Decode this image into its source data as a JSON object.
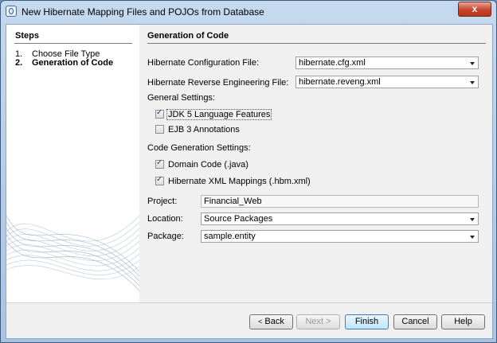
{
  "window": {
    "title": "New Hibernate Mapping Files and POJOs from Database",
    "close_glyph": "x"
  },
  "steps": {
    "heading": "Steps",
    "items": [
      {
        "num": "1.",
        "label": "Choose File Type"
      },
      {
        "num": "2.",
        "label": "Generation of Code",
        "active": true
      }
    ]
  },
  "main": {
    "heading": "Generation of Code",
    "config_file": {
      "label": "Hibernate Configuration File:",
      "value": "hibernate.cfg.xml"
    },
    "reveng_file": {
      "label": "Hibernate Reverse Engineering File:",
      "value": "hibernate.reveng.xml"
    },
    "general": {
      "label": "General Settings:",
      "jdk5": {
        "label": "JDK 5 Language Features",
        "checked": true
      },
      "ejb3": {
        "label": "EJB 3 Annotations",
        "checked": false
      }
    },
    "codegen": {
      "label": "Code Generation Settings:",
      "domain": {
        "label": "Domain Code (.java)",
        "checked": true
      },
      "hbm": {
        "label": "Hibernate XML Mappings (.hbm.xml)",
        "checked": true
      }
    },
    "project": {
      "label": "Project:",
      "value": "Financial_Web"
    },
    "location": {
      "label": "Location:",
      "value": "Source Packages"
    },
    "package": {
      "label": "Package:",
      "value": "sample.entity"
    }
  },
  "buttons": {
    "back": "Back",
    "next": "Next >",
    "finish": "Finish",
    "cancel": "Cancel",
    "help": "Help"
  },
  "icons": {
    "app": "netbeans-icon",
    "check": "✓",
    "back_arrow": "<"
  }
}
